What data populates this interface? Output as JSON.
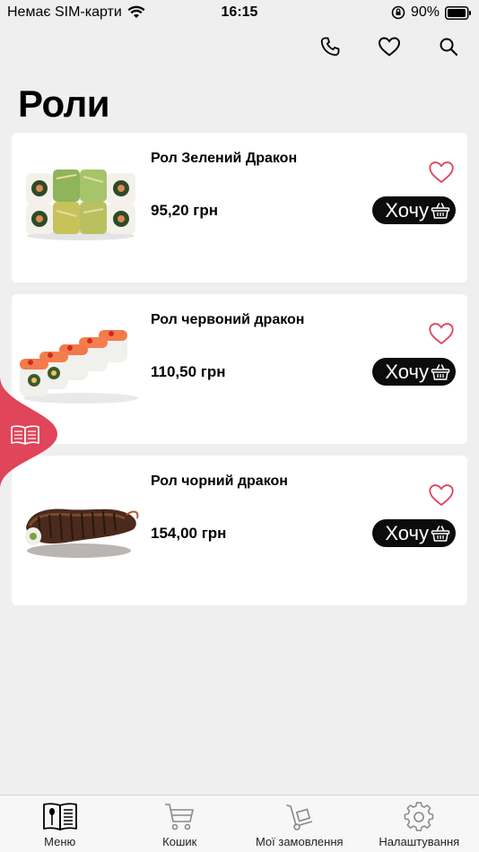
{
  "status_bar": {
    "carrier": "Немає SIM-карти",
    "time": "16:15",
    "battery": "90%"
  },
  "header": {
    "icons": [
      "phone-icon",
      "heart-icon",
      "search-icon"
    ]
  },
  "page_title": "Роли",
  "products": [
    {
      "name": "Рол Зелений Дракон",
      "price": "95,20 грн",
      "action_label": "Хочу"
    },
    {
      "name": "Рол червоний дракон",
      "price": "110,50 грн",
      "action_label": "Хочу"
    },
    {
      "name": "Рол чорний дракон",
      "price": "154,00 грн",
      "action_label": "Хочу"
    }
  ],
  "tabbar": {
    "items": [
      {
        "label": "Меню",
        "icon": "menu-book-icon"
      },
      {
        "label": "Кошик",
        "icon": "cart-icon"
      },
      {
        "label": "Мої замовлення",
        "icon": "hand-truck-icon"
      },
      {
        "label": "Налаштування",
        "icon": "gear-icon"
      }
    ]
  },
  "colors": {
    "accent": "#e0455a",
    "button": "#0c0c0c",
    "background": "#efefef"
  }
}
